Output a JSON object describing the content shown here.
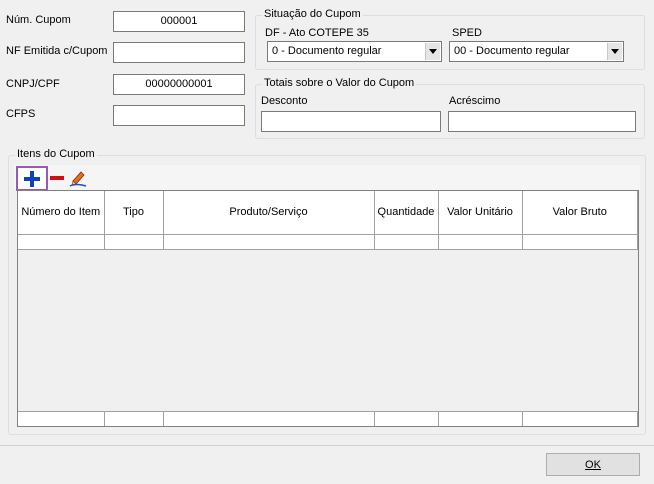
{
  "fields": {
    "num_cupom_label": "Núm. Cupom",
    "num_cupom_value": "000001",
    "nf_emitida_label": "NF Emitida c/Cupom",
    "nf_emitida_value": "",
    "cnpj_label": "CNPJ/CPF",
    "cnpj_value": "00000000001",
    "cfps_label": "CFPS",
    "cfps_value": ""
  },
  "situacao": {
    "title": "Situação do Cupom",
    "df_label": "DF - Ato COTEPE 35",
    "df_value": "0 - Documento regular",
    "sped_label": "SPED",
    "sped_value": "00 - Documento regular"
  },
  "totais": {
    "title": "Totais sobre o Valor do Cupom",
    "desconto_label": "Desconto",
    "desconto_value": "",
    "acrescimo_label": "Acréscimo",
    "acrescimo_value": ""
  },
  "itens": {
    "title": "Itens do Cupom",
    "columns": [
      "Número do Item",
      "Tipo",
      "Produto/Serviço",
      "Quantidade",
      "Valor Unitário",
      "Valor Bruto"
    ],
    "toolbar": {
      "add_icon": "plus-icon",
      "remove_icon": "minus-icon",
      "edit_icon": "pencil-icon"
    }
  },
  "ok_button": "OK",
  "colors": {
    "add_highlight": "#9b59b6",
    "add_icon": "#1040c0",
    "remove_icon": "#d01010"
  }
}
